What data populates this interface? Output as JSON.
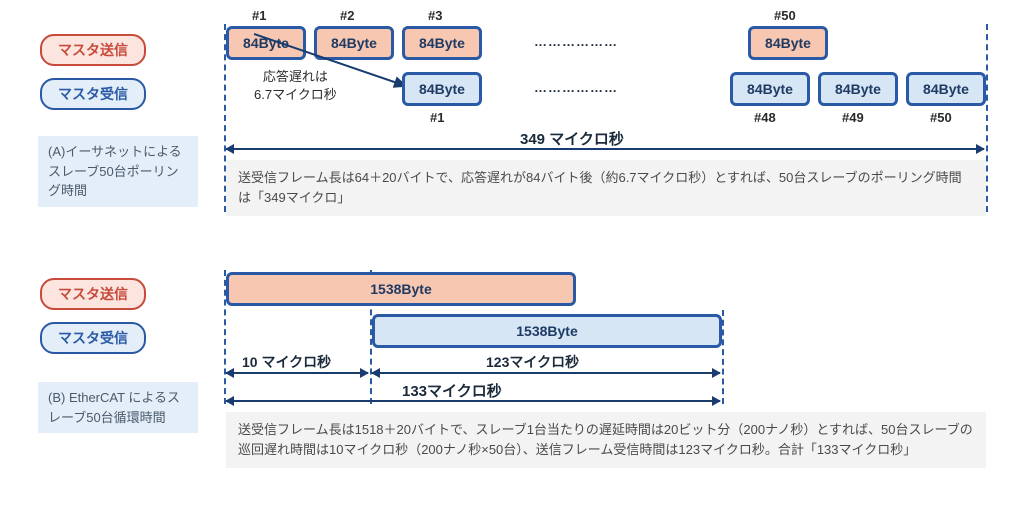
{
  "labels": {
    "master_send": "マスタ送信",
    "master_recv": "マスタ受信"
  },
  "sectionA": {
    "caption": "(A)イーサネットによるスレーブ50台ポーリング時間",
    "frame_label": "84Byte",
    "send_ticks": [
      "#1",
      "#2",
      "#3",
      "#50"
    ],
    "recv_ticks": [
      "#1",
      "#48",
      "#49",
      "#50"
    ],
    "delay_note": "応答遅れは\n6.7マイクロ秒",
    "dots": "………………",
    "total_time": "349 マイクロ秒",
    "note": "送受信フレーム長は64＋20バイトで、応答遅れが84バイト後（約6.7マイクロ秒）とすれば、50台スレーブのポーリング時間は「349マイクロ」"
  },
  "sectionB": {
    "caption": "(B) EtherCAT によるスレーブ50台循環時間",
    "frame_label": "1538Byte",
    "t_offset": "10 マイクロ秒",
    "t_recv": "123マイクロ秒",
    "t_total": "133マイクロ秒",
    "note": "送受信フレーム長は1518＋20バイトで、スレーブ1台当たりの遅延時間は20ビット分（200ナノ秒）とすれば、50台スレーブの巡回遅れ時間は10マイクロ秒（200ナノ秒×50台）、送信フレーム受信時間は123マイクロ秒。合計「133マイクロ秒」"
  },
  "chart_data": {
    "type": "diagram",
    "title": "Ethernet vs EtherCAT timing for 50 slaves",
    "A_ethernet": {
      "frame_bytes": 84,
      "frame_len_breakdown": "64+20",
      "response_delay_us": 6.7,
      "num_slaves": 50,
      "total_polling_time_us": 349
    },
    "B_ethercat": {
      "frame_bytes": 1538,
      "frame_len_breakdown": "1518+20",
      "per_slave_delay_bits": 20,
      "per_slave_delay_ns": 200,
      "num_slaves": 50,
      "ring_delay_us": 10,
      "frame_receive_time_us": 123,
      "total_cycle_time_us": 133
    }
  }
}
